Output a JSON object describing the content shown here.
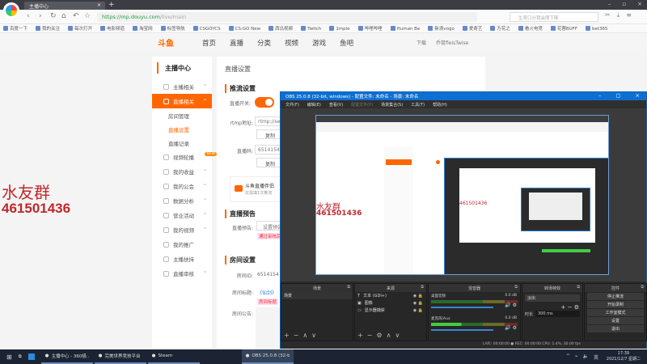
{
  "browser": {
    "tab_title": "主播中心",
    "url_host": "https://mp.douyu.com",
    "url_path": "/live/main",
    "search_placeholder": "生育口分我会席下降",
    "bookmarks": [
      "百度一下",
      "我的关注",
      "每次打开",
      "电影频道",
      "淘宝网",
      "标签导航",
      "CSGOYCS",
      "CS:GO New",
      "西瓜视频",
      "Twitch",
      "1mple",
      "哔哩哔哩",
      "Human Be",
      "新浪vogo",
      "爱奇艺",
      "万花之",
      "看火电竞",
      "花蓉BUFF",
      "bet365"
    ]
  },
  "douyu": {
    "logo": "斗鱼",
    "nav": [
      "首页",
      "直播",
      "分类",
      "视频",
      "游戏",
      "鱼吧"
    ],
    "download": "下载",
    "username": "乔鼠fleisTwise"
  },
  "sidebar": {
    "title": "主播中心",
    "items": [
      {
        "label": "主播相关",
        "caret": "^"
      },
      {
        "label": "直播相关",
        "caret": "^"
      },
      {
        "label": "房间管理"
      },
      {
        "label": "直播设置"
      },
      {
        "label": "直播记录"
      },
      {
        "label": "视频轮播",
        "badge": "NEW"
      },
      {
        "label": "我的收益",
        "caret": "^"
      },
      {
        "label": "我的公会",
        "caret": "^"
      },
      {
        "label": "数据分析",
        "caret": "^"
      },
      {
        "label": "营业活动",
        "caret": "^"
      },
      {
        "label": "我的视频",
        "caret": "^"
      },
      {
        "label": "我的推广"
      },
      {
        "label": "主播扶持"
      },
      {
        "label": "直播审核",
        "caret": "^"
      }
    ]
  },
  "main": {
    "page_title": "直播设置",
    "push_section": "推流设置",
    "live_switch_label": "直播开关:",
    "live_switch_on": true,
    "rtmp_label": "rtmp地址:",
    "rtmp_value": "rtmp://se",
    "copy": "复制",
    "code_label": "直播码:",
    "code_value": "6514154",
    "tip": "斗鱼直播伴侣",
    "tip_sub": "仅需填1次推流",
    "preview_section": "直播预告",
    "preview_label": "直播预告:",
    "preview_btn": "设置预告",
    "preview_warn": "通过审核后",
    "room_section": "房间设置",
    "room_id_label": "房间ID:",
    "room_id": "6514154",
    "room_title_label": "房间标题:",
    "room_title": "《仙剑》",
    "room_title_warn": "房间标题",
    "notice_label": "房间公告:"
  },
  "overlay": {
    "line1": "水友群",
    "line2": "461501436"
  },
  "obs": {
    "title": "OBS 25.0.8 (32-bit, windows) - 配置文件: 未命名 - 场景: 未命名",
    "menu": [
      "文件(F)",
      "编辑(E)",
      "查看(V)",
      "配置文件(P)",
      "场景集合(S)",
      "工具(T)",
      "帮助(H)"
    ],
    "docks": {
      "scenes": "场景",
      "sources": "来源",
      "mixer": "混音器",
      "transitions": "转场特效",
      "controls": "控件"
    },
    "scene_list": [
      "场景"
    ],
    "sources": [
      {
        "name": "文本 (GDI+)",
        "icon": "text-icon"
      },
      {
        "name": "图像",
        "icon": "image-icon"
      },
      {
        "name": "显示器捕获",
        "icon": "monitor-icon"
      }
    ],
    "mixer": [
      {
        "name": "桌面音频",
        "db": "0.0 dB"
      },
      {
        "name": "麦克风/Aux",
        "db": "0.0 dB"
      }
    ],
    "transition": "淡出",
    "duration_label": "时长",
    "duration": "300 ms",
    "controls": [
      "停止推流",
      "开始录制",
      "工作室模式",
      "设置",
      "退出"
    ],
    "status": "LIVE: 00:00:00  ●  REC: 00:00:00    CPU: 1.4%, 30.00 fps"
  },
  "taskbar": {
    "apps": [
      "主播中心 - 360极...",
      "完美世界竞技平台",
      "Steam",
      "OBS 25.0.8 (32-bit..."
    ],
    "time": "17:39",
    "date": "2021/12/7 星期二"
  }
}
